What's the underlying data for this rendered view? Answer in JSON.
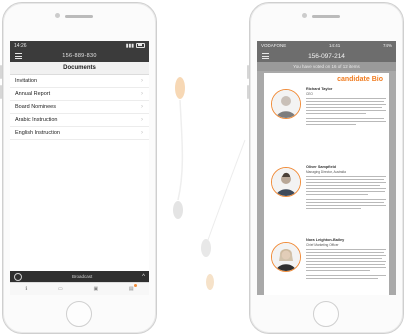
{
  "left_phone": {
    "status": {
      "time": "14:26"
    },
    "header": {
      "phone_number": "156-889-830"
    },
    "documents": {
      "title": "Documents",
      "items": [
        {
          "label": "Invitation"
        },
        {
          "label": "Annual Report"
        },
        {
          "label": "Board Nominees"
        },
        {
          "label": "Arabic Instruction"
        },
        {
          "label": "English Instruction"
        }
      ]
    },
    "toolbar": {
      "label": "Broadcast"
    }
  },
  "right_phone": {
    "status": {
      "carrier": "VODAFONE",
      "time": "14:41",
      "battery": "74%"
    },
    "header": {
      "phone_number": "156-097-214"
    },
    "banner": "You have voted on 16 of 12 items",
    "brand": {
      "name": "candidate Bio",
      "color": "#f07d22"
    },
    "candidates": [
      {
        "name": "Richard Taylor",
        "role": "CEO"
      },
      {
        "name": "Oliver Sampfield",
        "role": "Managing Director, Australia"
      },
      {
        "name": "Nora Leighton-Bailey",
        "role": "Chief Marketing Officer"
      }
    ]
  },
  "colors": {
    "accent": "#f08c3a",
    "dark_bar": "#3b3b3b",
    "gray_bar": "#6d6d6d"
  }
}
